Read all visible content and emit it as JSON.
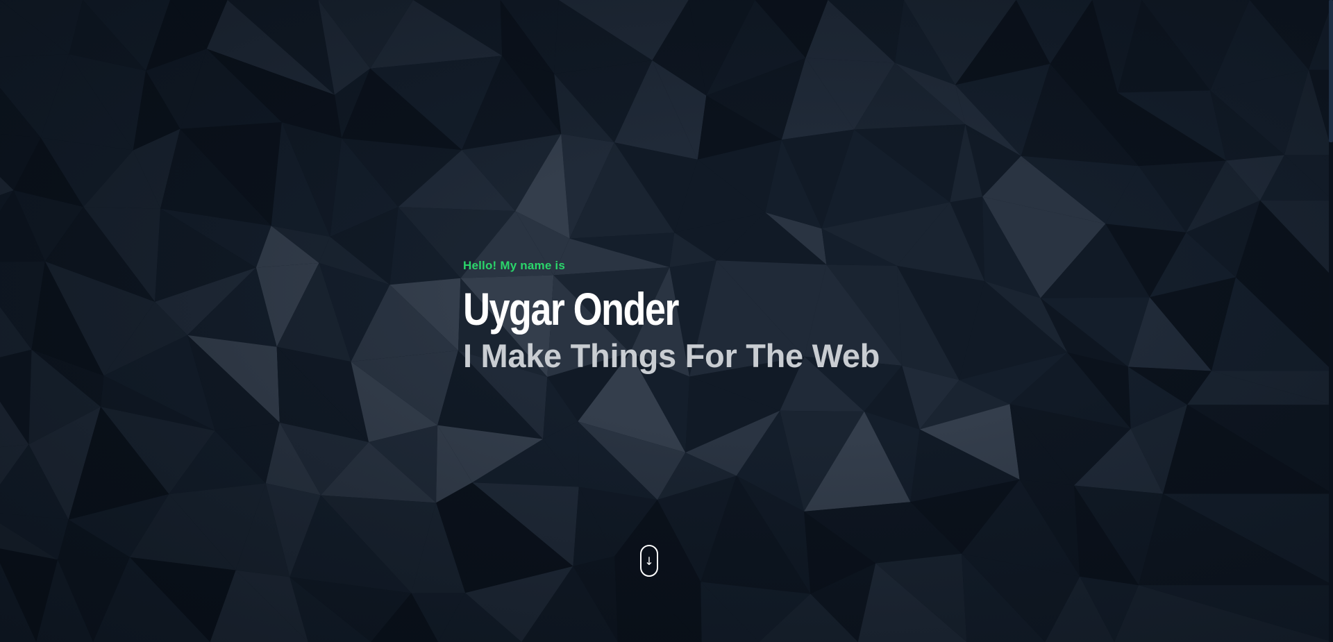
{
  "hero": {
    "greeting": "Hello! My name is",
    "name": "Uygar Onder",
    "tagline": "I Make Things For The Web",
    "scroll_icon": "arrow-down-icon",
    "scroll_glyph": "↓"
  },
  "colors": {
    "background": "#0a111b",
    "accent": "#2bd66b",
    "name_text": "#ffffff",
    "tagline_text": "#c9cdd2"
  }
}
